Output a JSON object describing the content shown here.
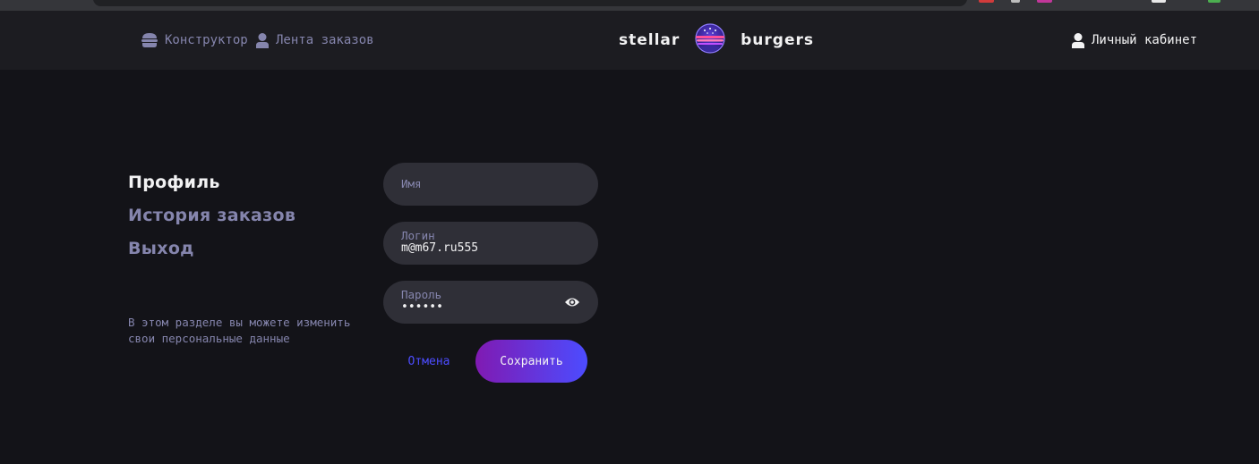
{
  "header": {
    "nav_constructor": "Конструктор",
    "nav_feed": "Лента заказов",
    "logo_left": "stellar",
    "logo_right": "burgers",
    "nav_account": "Личный кабинет"
  },
  "profile_nav": {
    "profile": "Профиль",
    "history": "История заказов",
    "logout": "Выход"
  },
  "note": "В этом разделе вы можете изменить свои персональные данные",
  "form": {
    "name": {
      "placeholder": "Имя"
    },
    "login": {
      "label": "Логин",
      "value": "m@m67.ru555"
    },
    "password": {
      "label": "Пароль",
      "value": "••••••"
    },
    "cancel": "Отмена",
    "save": "Сохранить"
  },
  "colors": {
    "background": "#131318",
    "header": "#1c1c21",
    "input": "#2f2f37",
    "inactive_text": "#8585ad",
    "accent": "#4c4cff",
    "accent_purple": "#801ab2"
  }
}
